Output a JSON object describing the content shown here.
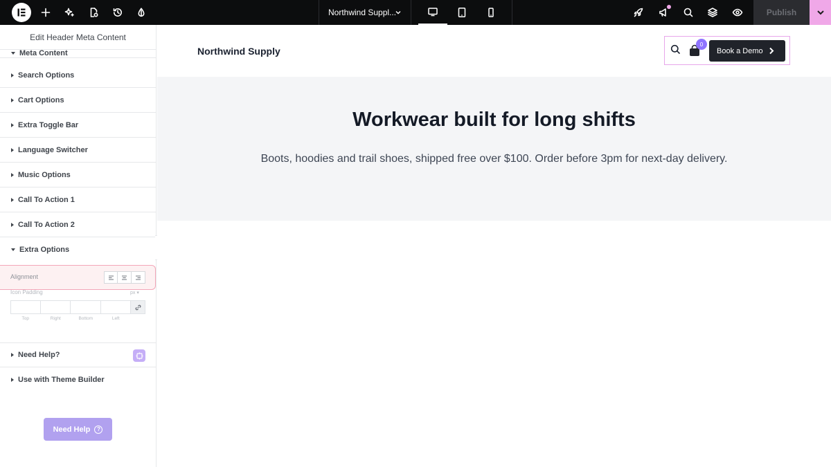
{
  "topbar": {
    "document_title": "Northwind Suppl...",
    "publish_label": "Publish",
    "colors": {
      "bar": "#0c0d0e",
      "accent": "#f0a8e8"
    }
  },
  "panel": {
    "title": "Edit Header Meta Content",
    "partial_section": "Meta Content",
    "sections": [
      "Search Options",
      "Cart Options",
      "Extra Toggle Bar",
      "Language Switcher",
      "Music Options",
      "Call To Action 1",
      "Call To Action 2",
      "Extra Options"
    ],
    "alignment_label": "Alignment",
    "icon_padding_label": "Icon Padding",
    "icon_padding_unit": "px",
    "padding_captions": [
      "Top",
      "Right",
      "Bottom",
      "Left"
    ],
    "bottom_sections": [
      "Need Help?",
      "Use with Theme Builder"
    ],
    "help_button_label": "Need Help"
  },
  "site": {
    "brand": "Northwind Supply",
    "cart_count": "0",
    "cta_label": "Book a Demo",
    "hero_title": "Workwear built for long shifts",
    "hero_subtitle": "Boots, hoodies and trail shoes, shipped free over $100. Order before 3pm for next-day delivery."
  },
  "icons": [
    "elementor-logo-icon",
    "plus-icon",
    "sparkle-icon",
    "page-settings-icon",
    "history-icon",
    "color-drop-icon",
    "chevron-down-icon",
    "desktop-icon",
    "tablet-icon",
    "mobile-icon",
    "rocket-icon",
    "megaphone-icon",
    "search-icon",
    "layers-icon",
    "eye-icon",
    "cart-icon",
    "chevron-right-icon",
    "link-icon",
    "help-circle-icon"
  ]
}
